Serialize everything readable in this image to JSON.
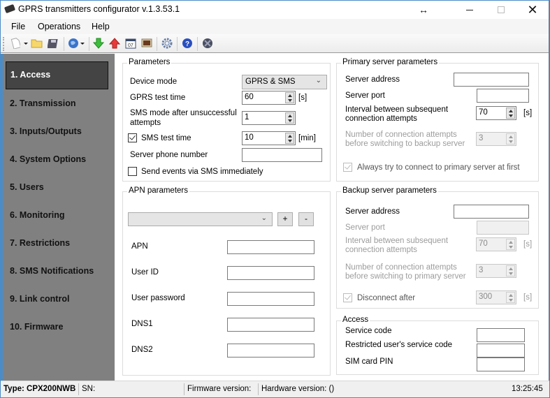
{
  "window": {
    "title": "GPRS transmitters configurator v.1.3.53.1"
  },
  "menu": [
    "File",
    "Operations",
    "Help"
  ],
  "toolbar": {
    "icons": [
      "new-document-icon",
      "open-folder-icon",
      "save-disk-icon",
      "globe-connect-icon",
      "download-arrow-icon",
      "upload-arrow-icon",
      "calendar-icon",
      "monitor-icon",
      "settings-gear-icon",
      "help-icon",
      "disconnect-icon"
    ]
  },
  "sidebar": {
    "items": [
      {
        "label": "1. Access",
        "active": true
      },
      {
        "label": "2. Transmission"
      },
      {
        "label": "3. Inputs/Outputs"
      },
      {
        "label": "4. System Options"
      },
      {
        "label": "5. Users"
      },
      {
        "label": "6. Monitoring"
      },
      {
        "label": "7. Restrictions"
      },
      {
        "label": "8. SMS Notifications"
      },
      {
        "label": "9. Link control"
      },
      {
        "label": "10. Firmware"
      }
    ]
  },
  "parameters": {
    "legend": "Parameters",
    "device_mode_label": "Device mode",
    "device_mode_value": "GPRS & SMS",
    "gprs_test_time_label": "GPRS test time",
    "gprs_test_time_value": "60",
    "gprs_test_time_unit": "[s]",
    "sms_mode_label_1": "SMS mode after unsuccessful",
    "sms_mode_label_2": "attempts",
    "sms_mode_value": "1",
    "sms_test_time_label": "SMS test time",
    "sms_test_time_checked": true,
    "sms_test_time_value": "10",
    "sms_test_time_unit": "[min]",
    "server_phone_label": "Server phone number",
    "server_phone_value": "",
    "send_events_label": "Send events via SMS immediately",
    "send_events_checked": false
  },
  "apn": {
    "legend": "APN parameters",
    "profile_value": "",
    "add_label": "+",
    "remove_label": "-",
    "apn_label": "APN",
    "user_id_label": "User ID",
    "user_password_label": "User password",
    "dns1_label": "DNS1",
    "dns2_label": "DNS2"
  },
  "primary": {
    "legend": "Primary server parameters",
    "server_address_label": "Server address",
    "server_port_label": "Server port",
    "interval_label_1": "Interval between subsequent",
    "interval_label_2": "connection attempts",
    "interval_value": "70",
    "interval_unit": "[s]",
    "attempts_label_1": "Number of connection attempts",
    "attempts_label_2": "before switching to backup server",
    "attempts_value": "3",
    "always_try_label": "Always try to connect to primary server at first",
    "always_try_checked": true
  },
  "backup": {
    "legend": "Backup server parameters",
    "server_address_label": "Server address",
    "server_port_label": "Server port",
    "interval_label_1": "Interval between subsequent",
    "interval_label_2": "connection attempts",
    "interval_value": "70",
    "interval_unit": "[s]",
    "attempts_label_1": "Number of connection attempts",
    "attempts_label_2": "before switching to primary server",
    "attempts_value": "3",
    "disconnect_label": "Disconnect after",
    "disconnect_checked": true,
    "disconnect_value": "300",
    "disconnect_unit": "[s]"
  },
  "access": {
    "legend": "Access",
    "service_code_label": "Service code",
    "restricted_code_label": "Restricted user's service code",
    "sim_pin_label": "SIM card PIN"
  },
  "status": {
    "type": "Type: CPX200NWB",
    "sn": "SN:",
    "firmware": "Firmware version:",
    "hardware": "Hardware version: ()",
    "time": "13:25:45"
  }
}
